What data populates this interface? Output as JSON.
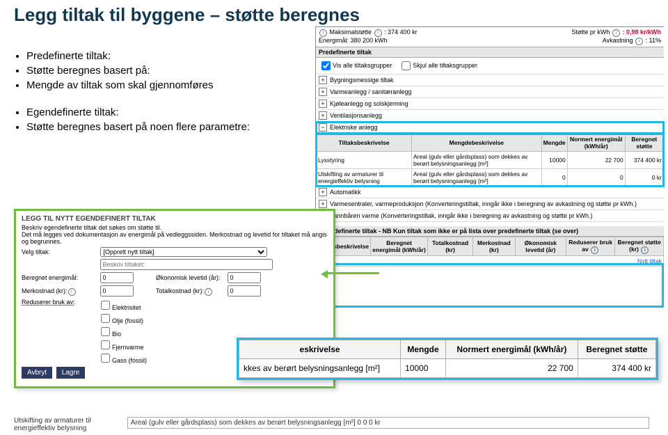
{
  "title": "Legg tiltak til byggene – støtte beregnes",
  "left": {
    "b1": "Predefinerte tiltak:",
    "b2": "Støtte beregnes basert på:",
    "b3": "Mengde av tiltak som skal gjennomføres",
    "b4": "Egendefinerte tiltak:",
    "b5": "Støtte beregnes basert på noen flere parametre:"
  },
  "header": {
    "maxstotte_lbl": "Maksimalstøtte",
    "maxstotte_val": ": 374 400 kr",
    "energimal_lbl": "Energimål: 380 200 kWh",
    "stottepr_lbl": "Støtte pr kWh",
    "stottepr_val": ": 0,98 kr/kWh",
    "avkast_lbl": "Avkastning",
    "avkast_val": ": 11%"
  },
  "predef": {
    "section": "Predefinerte tiltak",
    "visalle": "Vis alle tiltaksgrupper",
    "skjulalle": "Skjul alle tiltaksgrupper",
    "groups": {
      "bygg": "Bygningsmessige tiltak",
      "varme": "Varmeanlegg / sanitæranlegg",
      "kjole": "Kjøleanlegg og solskjerming",
      "vent": "Ventilasjonsanlegg",
      "elektr": "Elektriske anlegg",
      "auto": "Automatikk",
      "varmesentral": "Varmesentraler, varmeproduksjon (Konverteringstiltak, inngår ikke i beregning av avkastning og støtte pr kWh.)",
      "vannbaren": "Vannbåren varme (Konverteringstiltak, inngår ikke i beregning av avkastning og støtte pr kWh.)"
    }
  },
  "etable": {
    "h1": "Tiltaksbeskrivelse",
    "h2": "Mengdebeskrivelse",
    "h3": "Mengde",
    "h4": "Normert energimål (kWh/år)",
    "h5": "Beregnet støtte",
    "r1c1": "Lysstyring",
    "r1c2": "Areal (gulv eller gårdsplass) som dekkes av berørt belysningsanlegg [m²]",
    "r1c3": "10000",
    "r1c4": "22 700",
    "r1c5": "374 400 kr",
    "r2c1": "Utskifting av armaturer til energieffektiv belysning",
    "r2c2": "Areal (gulv eller gårdsplass) som dekkes av berørt belysningsanlegg [m²]",
    "r2c3": "0",
    "r2c4": "0",
    "r2c5": "0 kr"
  },
  "egendef": {
    "section": "Egendefinerte tiltak - NB Kun tiltak som ikke er på lista over predefinerte tiltak (se over)",
    "h1": "Tiltaksbeskrivelse",
    "h2": "Beregnet energimål (kWh/år)",
    "h3": "Totalkostnad (kr)",
    "h4": "Merkostnad (kr)",
    "h5": "Økonomisk levetid (år)",
    "h6": "Reduserer bruk av",
    "h7": "Beregnet støtte (kr)",
    "new": "Nytt tiltak"
  },
  "modal": {
    "title": "LEGG TIL NYTT EGENDEFINERT TILTAK",
    "sub1": "Beskriv egendefinerte tiltak det søkes om støtte til.",
    "sub2": "Det må legges ved dokumentasjon av energimål på vedleggssiden. Merkostnad og levetid for tiltaket må angis og begrunnes.",
    "velg_lbl": "Velg tiltak:",
    "velg_opt": "[Opprett nytt tiltak]",
    "beskr_ph": "Beskriv tiltaket:",
    "bereg_lbl": "Beregnet energimål:",
    "bereg_val": "0",
    "oklev_lbl": "Økonomisk levetid (år):",
    "oklev_val": "0",
    "merk_lbl": "Merkostnad (kr):",
    "merk_val": "0",
    "totk_lbl": "Totalkostnad (kr):",
    "totk_val": "0",
    "red_lbl": "Reduserer bruk av:",
    "c1": "Elektrisitet",
    "c2": "Olje (fossil)",
    "c3": "Bio",
    "c4": "Fjernvarme",
    "c5": "Gass (fossil)",
    "avbryt": "Avbryt",
    "lagre": "Lagre"
  },
  "bottomrow": {
    "first": "Utskifting av armaturer til energieffektiv belysning",
    "rest": "Areal (gulv eller gårdsplass) som dekkes av berørt belysningsanlegg [m²]        0            0          0 kr"
  },
  "zoom": {
    "h1": "eskrivelse",
    "h2": "Mengde",
    "h3": "Normert energimål (kWh/år)",
    "h4": "Beregnet støtte",
    "r1c1": "kkes av berørt belysningsanlegg [m²]",
    "r1c2": "10000",
    "r1c3": "22 700",
    "r1c4": "374 400 kr"
  }
}
